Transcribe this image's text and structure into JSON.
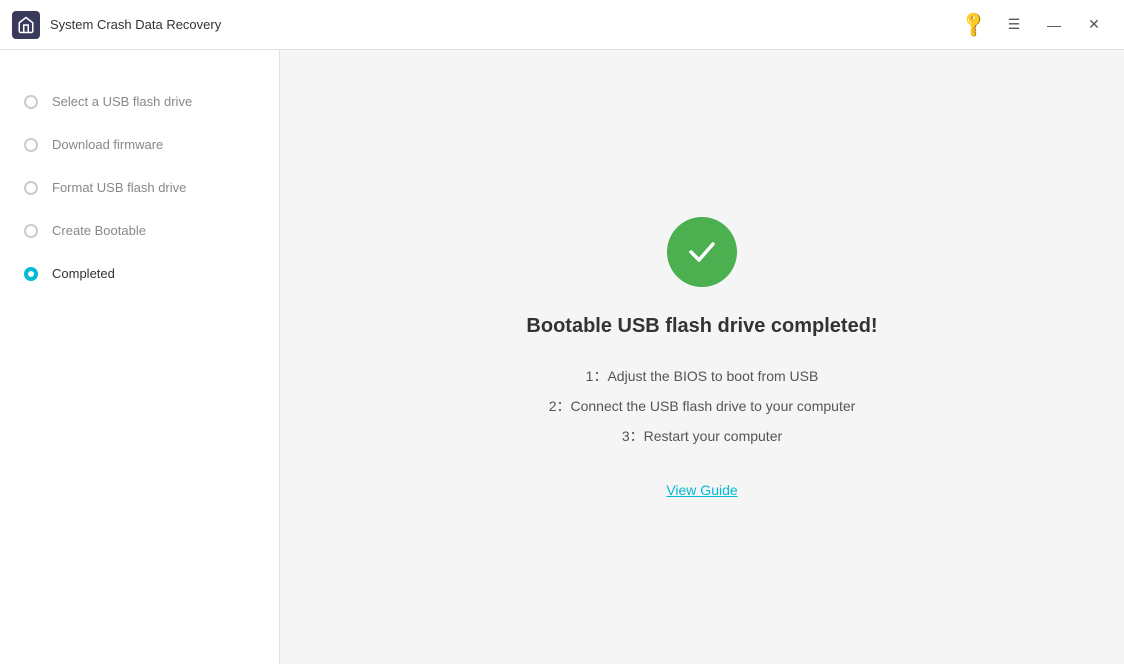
{
  "titlebar": {
    "title": "System Crash Data Recovery",
    "controls": {
      "minimize": "—",
      "maximize": "☰",
      "close": "✕"
    }
  },
  "sidebar": {
    "items": [
      {
        "id": "select-usb",
        "label": "Select a USB flash drive",
        "state": "done"
      },
      {
        "id": "download-firmware",
        "label": "Download firmware",
        "state": "done"
      },
      {
        "id": "format-usb",
        "label": "Format USB flash drive",
        "state": "done"
      },
      {
        "id": "create-bootable",
        "label": "Create Bootable",
        "state": "done"
      },
      {
        "id": "completed",
        "label": "Completed",
        "state": "active"
      }
    ]
  },
  "main": {
    "completed_title": "Bootable USB flash drive completed!",
    "instructions": [
      {
        "num": "1",
        "text": "Adjust the BIOS to boot from USB"
      },
      {
        "num": "2",
        "text": "Connect the USB flash drive to your computer"
      },
      {
        "num": "3",
        "text": "Restart your computer"
      }
    ],
    "view_guide_label": "View Guide"
  }
}
